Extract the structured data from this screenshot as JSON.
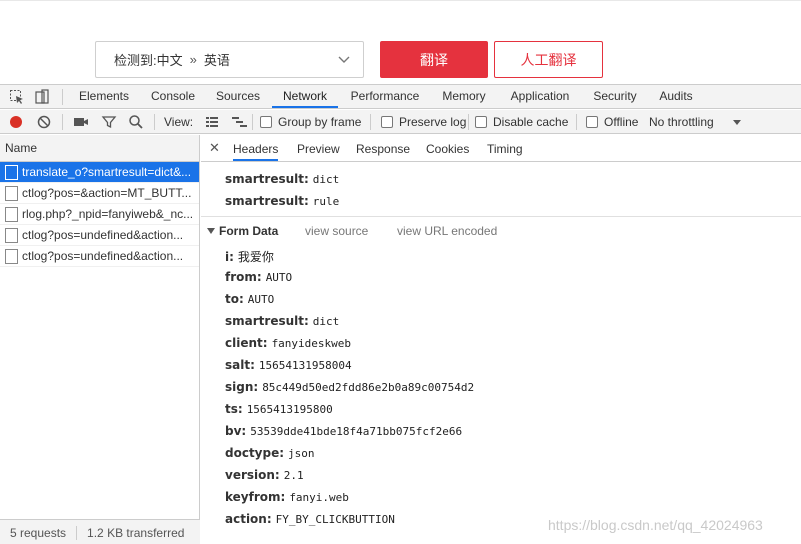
{
  "translator": {
    "detect_label": "检测到:",
    "source_lang": "中文",
    "arrow": "»",
    "target_lang": "英语",
    "translate_button": "翻译",
    "human_translate_button": "人工翻译"
  },
  "devtools": {
    "tabs": [
      "Elements",
      "Console",
      "Sources",
      "Network",
      "Performance",
      "Memory",
      "Application",
      "Security",
      "Audits"
    ],
    "active_tab": "Network",
    "toolbar": {
      "view_label": "View:",
      "group_by_frame": "Group by frame",
      "preserve_log": "Preserve log",
      "disable_cache": "Disable cache",
      "offline": "Offline",
      "throttling": "No throttling"
    },
    "request_list": {
      "header": "Name",
      "rows": [
        "translate_o?smartresult=dict&...",
        "ctlog?pos=&action=MT_BUTT...",
        "rlog.php?_npid=fanyiweb&_nc...",
        "ctlog?pos=undefined&action...",
        "ctlog?pos=undefined&action..."
      ],
      "status_requests": "5 requests",
      "status_transferred": "1.2 KB transferred"
    },
    "detail": {
      "tabs": [
        "Headers",
        "Preview",
        "Response",
        "Cookies",
        "Timing"
      ],
      "query_params": [
        {
          "key": "smartresult:",
          "value": "dict"
        },
        {
          "key": "smartresult:",
          "value": "rule"
        }
      ],
      "form_data_title": "Form Data",
      "view_source": "view source",
      "view_url_encoded": "view URL encoded",
      "form_data": [
        {
          "key": "i:",
          "value": "我爱你"
        },
        {
          "key": "from:",
          "value": "AUTO"
        },
        {
          "key": "to:",
          "value": "AUTO"
        },
        {
          "key": "smartresult:",
          "value": "dict"
        },
        {
          "key": "client:",
          "value": "fanyideskweb"
        },
        {
          "key": "salt:",
          "value": "15654131958004"
        },
        {
          "key": "sign:",
          "value": "85c449d50ed2fdd86e2b0a89c00754d2"
        },
        {
          "key": "ts:",
          "value": "1565413195800"
        },
        {
          "key": "bv:",
          "value": "53539dde41bde18f4a71bb075fcf2e66"
        },
        {
          "key": "doctype:",
          "value": "json"
        },
        {
          "key": "version:",
          "value": "2.1"
        },
        {
          "key": "keyfrom:",
          "value": "fanyi.web"
        },
        {
          "key": "action:",
          "value": "FY_BY_CLICKBUTTION"
        }
      ]
    }
  },
  "watermark": "https://blog.csdn.net/qq_42024963",
  "colors": {
    "brand_red": "#e5323e",
    "active_blue": "#1a73e8",
    "record_red": "#d93025"
  }
}
